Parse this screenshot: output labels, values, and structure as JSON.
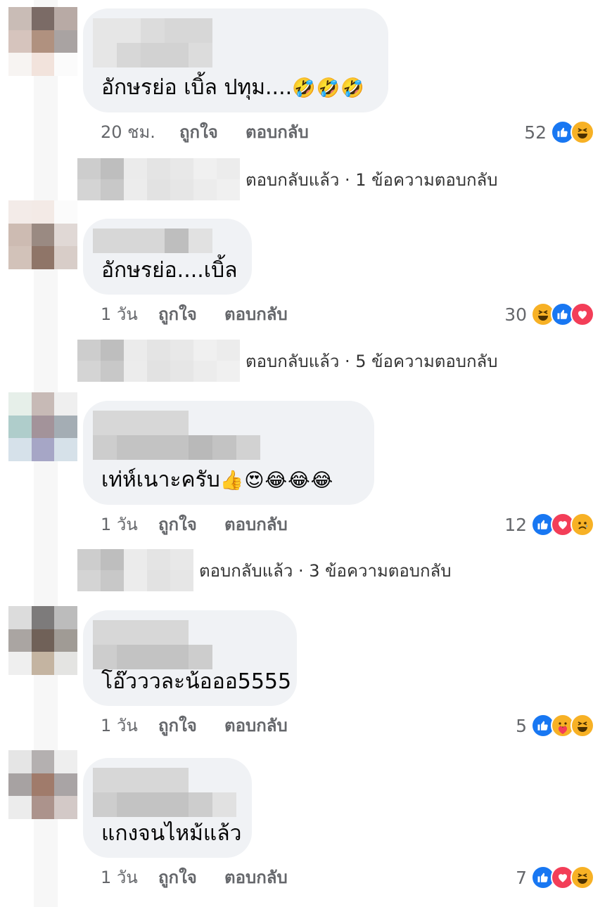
{
  "actions": {
    "like": "ถูกใจ",
    "reply": "ตอบกลับ"
  },
  "comments": [
    {
      "text": "อักษรย่อ เบิ้ล ปทุม....",
      "emoji": "🤣🤣🤣",
      "time": "20 ชม.",
      "reaction_count": "52",
      "reactions": [
        "like",
        "haha"
      ],
      "reply_summary": "ตอบกลับแล้ว · 1 ข้อความตอบกลับ"
    },
    {
      "text": "อักษรย่อ....เบิ้ล",
      "emoji": "",
      "time": "1 วัน",
      "reaction_count": "30",
      "reactions": [
        "haha",
        "like",
        "love"
      ],
      "reply_summary": "ตอบกลับแล้ว · 5 ข้อความตอบกลับ"
    },
    {
      "text": "เท่ห์เนาะครับ",
      "emoji": "👍😍😂😂😂",
      "time": "1 วัน",
      "reaction_count": "12",
      "reactions": [
        "like",
        "love",
        "sad"
      ],
      "reply_summary": "ตอบกลับแล้ว · 3 ข้อความตอบกลับ"
    },
    {
      "text": "โอ๊วววละน้อออ5555",
      "emoji": "",
      "time": "1 วัน",
      "reaction_count": "5",
      "reactions": [
        "like",
        "care",
        "haha"
      ],
      "reply_summary": ""
    },
    {
      "text": "แกงจนไหม้แล้ว",
      "emoji": "",
      "time": "1 วัน",
      "reaction_count": "7",
      "reactions": [
        "like",
        "love",
        "haha"
      ],
      "reply_summary": ""
    }
  ],
  "colors": {
    "bubble": "#f0f2f5",
    "secondary_text": "#65676b",
    "like_blue": "#1877f2",
    "love_red": "#f33e58",
    "haha_yellow": "#f7b125"
  },
  "icons": {
    "like": "like-reaction-icon",
    "love": "love-reaction-icon",
    "haha": "haha-reaction-icon",
    "sad": "sad-reaction-icon",
    "care": "care-reaction-icon"
  }
}
